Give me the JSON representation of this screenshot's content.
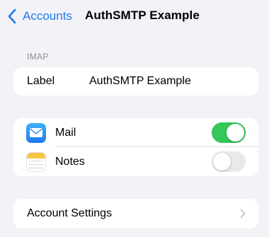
{
  "nav": {
    "back_label": "Accounts",
    "title": "AuthSMTP Example"
  },
  "imap": {
    "header": "IMAP",
    "label_key": "Label",
    "label_value": "AuthSMTP Example"
  },
  "apps": [
    {
      "name": "Mail",
      "icon": "mail-icon",
      "enabled": true
    },
    {
      "name": "Notes",
      "icon": "notes-icon",
      "enabled": false
    }
  ],
  "settings": {
    "label": "Account Settings"
  },
  "colors": {
    "accent": "#1a7cf0",
    "toggle_on": "#34c759",
    "toggle_off": "#e9e9eb",
    "background": "#f2f2f7"
  }
}
